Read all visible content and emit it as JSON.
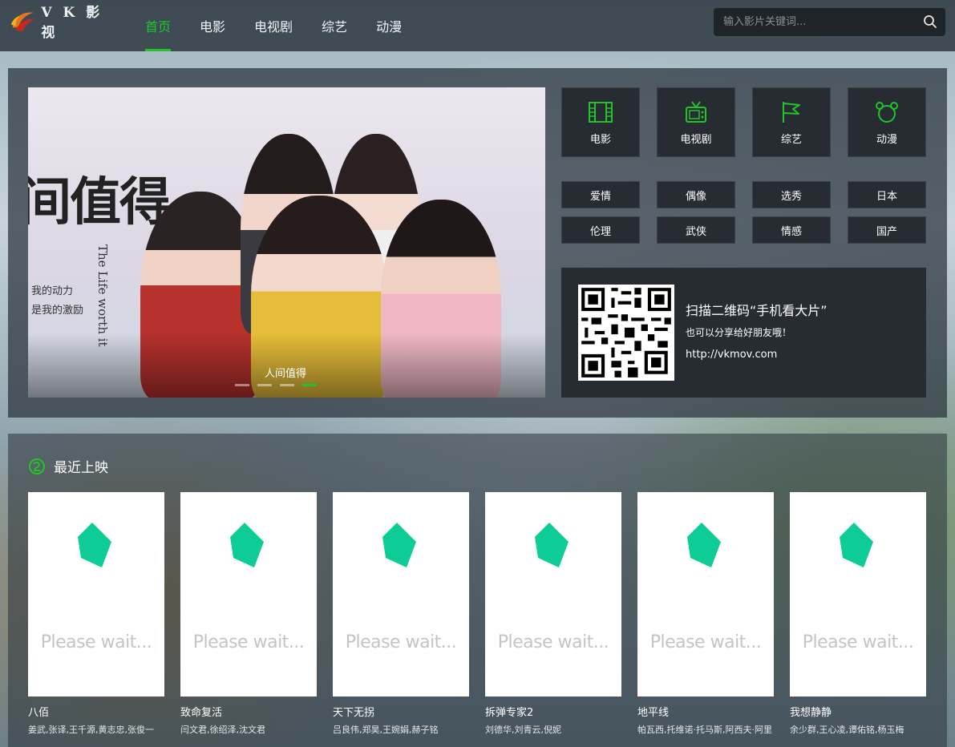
{
  "brand": {
    "name": "V K 影视"
  },
  "nav": {
    "items": [
      {
        "label": "首页",
        "active": true
      },
      {
        "label": "电影",
        "active": false
      },
      {
        "label": "电视剧",
        "active": false
      },
      {
        "label": "综艺",
        "active": false
      },
      {
        "label": "动漫",
        "active": false
      }
    ]
  },
  "search": {
    "placeholder": "输入影片关键词...",
    "value": ""
  },
  "banner": {
    "caption": "人间值得",
    "image_title": "间值得",
    "image_english": "The Life worth it",
    "image_sub_1": "我的动力",
    "image_sub_2": "是我的激励",
    "slides": 4,
    "active_slide": 4
  },
  "categories": [
    {
      "label": "电影",
      "icon": "film-icon"
    },
    {
      "label": "电视剧",
      "icon": "tv-icon"
    },
    {
      "label": "综艺",
      "icon": "flag-icon"
    },
    {
      "label": "动漫",
      "icon": "bear-icon"
    }
  ],
  "tags": [
    "爱情",
    "偶像",
    "选秀",
    "日本",
    "伦理",
    "武侠",
    "情感",
    "国产"
  ],
  "qr": {
    "title": "扫描二维码“手机看大片”",
    "subtitle": "也可以分享给好朋友哦！",
    "url": "http://vkmov.com"
  },
  "recent": {
    "title": "最近上映",
    "placeholder_text": "Please wait...",
    "movies": [
      {
        "title": "八佰",
        "cast": "姜武,张译,王千源,黄志忠,张俊一"
      },
      {
        "title": "致命复活",
        "cast": "闫文君,徐绍泽,沈文君"
      },
      {
        "title": "天下无拐",
        "cast": "吕良伟,郑昊,王婉娟,赫子铭"
      },
      {
        "title": "拆弹专家2",
        "cast": "刘德华,刘青云,倪妮"
      },
      {
        "title": "地平线",
        "cast": "帕瓦西,托维诺·托马斯,阿西夫·阿里"
      },
      {
        "title": "我想静静",
        "cast": "余少群,王心凌,谭佑铭,杨玉梅"
      }
    ]
  },
  "colors": {
    "accent": "#22c32b",
    "panel": "#262c31",
    "poster_icon": "#0dcc95"
  }
}
